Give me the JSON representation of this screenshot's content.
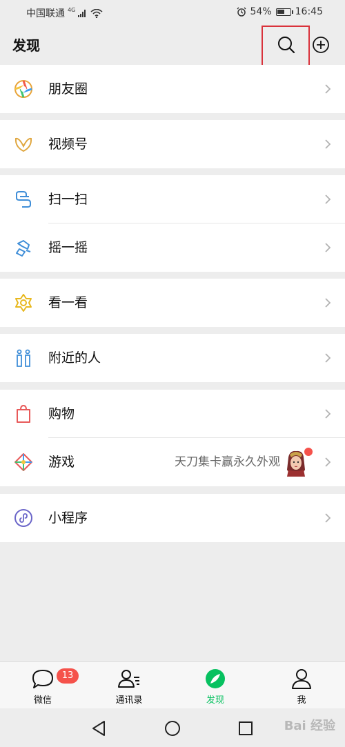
{
  "status_bar": {
    "carrier": "中国联通",
    "network": "4G",
    "battery": "54%",
    "battery_level": 0.54,
    "time": "16:45"
  },
  "header": {
    "title": "发现"
  },
  "menu": {
    "moments": "朋友圈",
    "channels": "视频号",
    "scan": "扫一扫",
    "shake": "摇一摇",
    "top_stories": "看一看",
    "people_nearby": "附近的人",
    "shopping": "购物",
    "games": "游戏",
    "games_promo": "天刀集卡赢永久外观",
    "mini_programs": "小程序"
  },
  "tabs": {
    "chats": "微信",
    "chats_badge": "13",
    "contacts": "通讯录",
    "discover": "发现",
    "me": "我"
  },
  "colors": {
    "accent": "#07c160",
    "badge": "#f5524b",
    "highlight": "#d9323b"
  },
  "watermark": "Bai 经验"
}
